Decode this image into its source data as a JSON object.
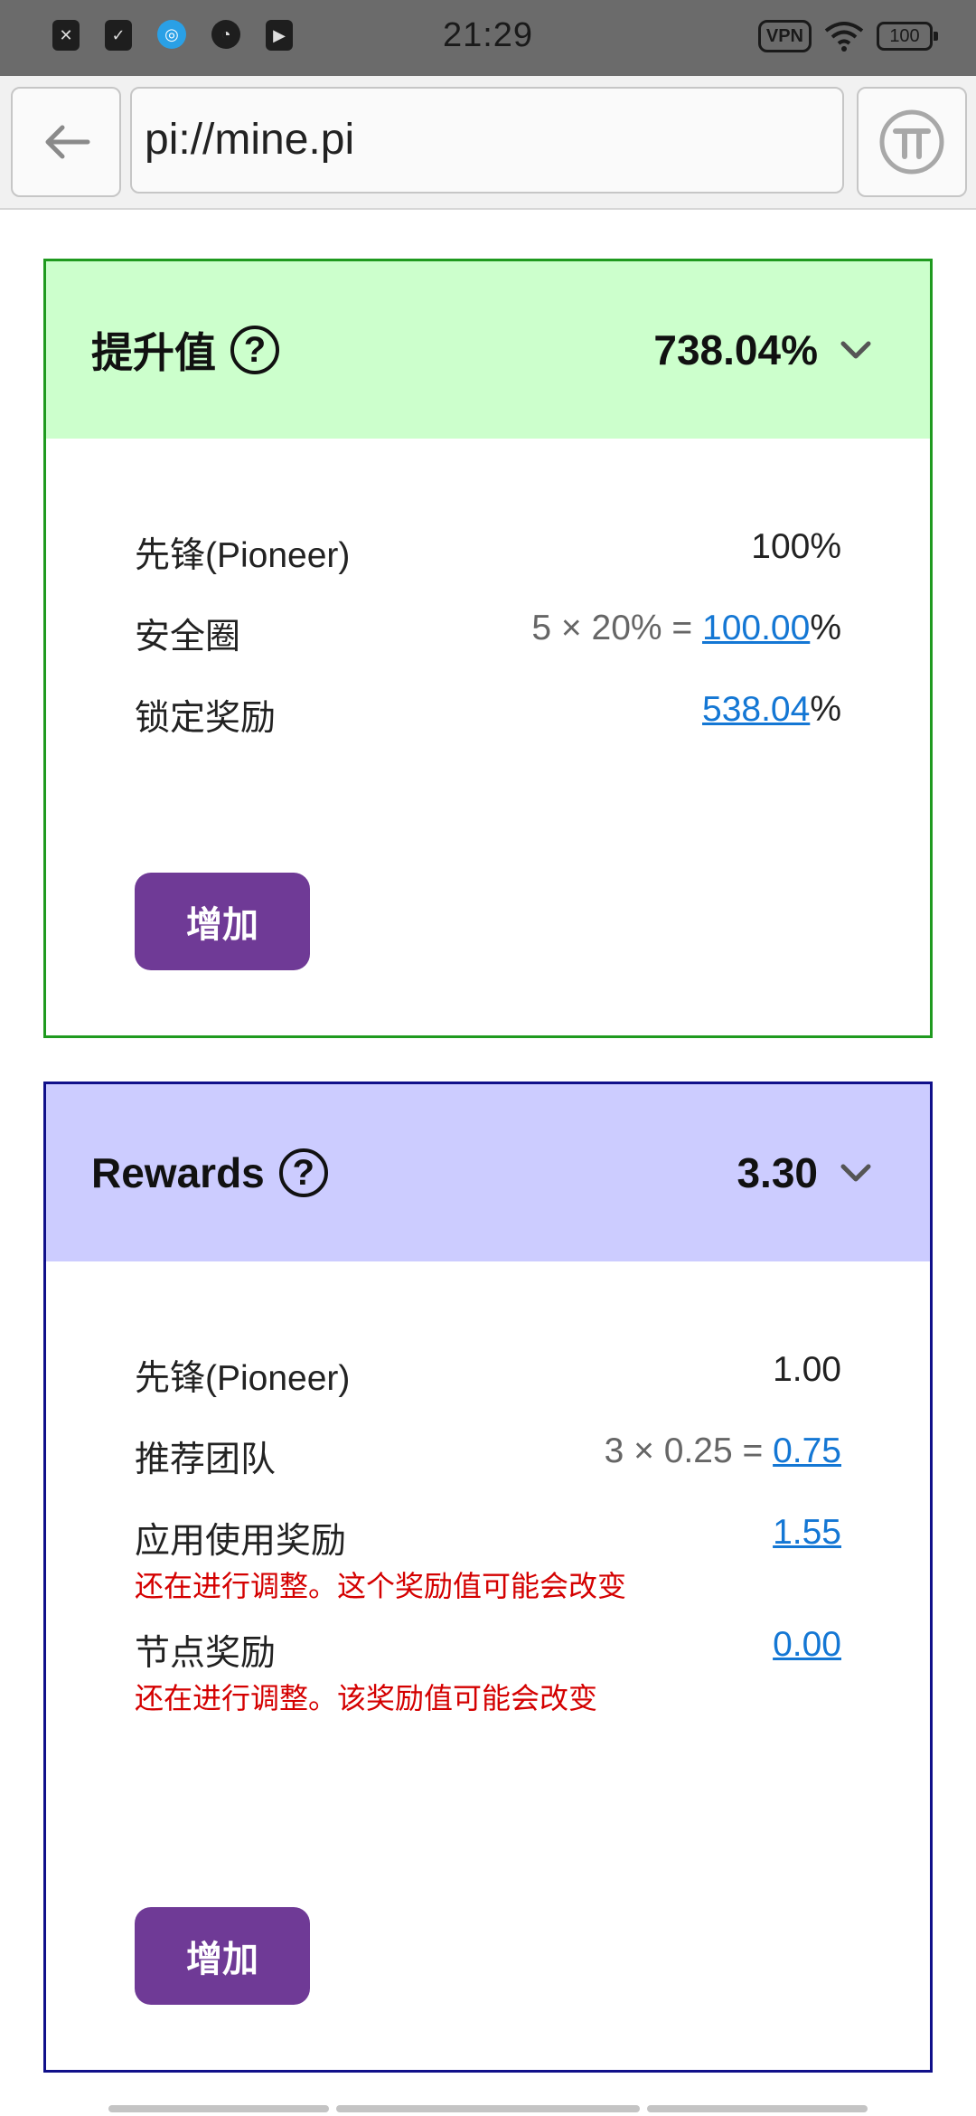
{
  "status_bar": {
    "time": "21:29",
    "vpn": "VPN",
    "battery": "100",
    "icons": [
      "close-notification-icon",
      "clipboard-check-icon",
      "app-blue-icon",
      "speed-icon",
      "media-icon"
    ]
  },
  "browser": {
    "url": "pi://mine.pi",
    "back_icon": "arrow-left-icon",
    "pi_icon": "pi-logo-icon"
  },
  "boost_card": {
    "title": "提升值",
    "help": "?",
    "value": "738.04%",
    "rows": [
      {
        "label": "先锋(Pioneer)",
        "value_plain": "100%"
      },
      {
        "label": "安全圈",
        "calc": "5 × 20% = ",
        "link": "100.00",
        "suffix": "%"
      },
      {
        "label": "锁定奖励",
        "link": "538.04",
        "suffix": "%"
      }
    ],
    "button": "增加",
    "border_color": "#1f9a1f",
    "header_color": "#ccffcc"
  },
  "rewards_card": {
    "title": "Rewards",
    "help": "?",
    "value": "3.30",
    "rows": [
      {
        "label": "先锋(Pioneer)",
        "value_plain": "1.00"
      },
      {
        "label": "推荐团队",
        "calc": "3 × 0.25 = ",
        "link": "0.75"
      },
      {
        "label": "应用使用奖励",
        "link": "1.55",
        "warning": "还在进行调整。这个奖励值可能会改变"
      },
      {
        "label": "节点奖励",
        "link": "0.00",
        "warning": "还在进行调整。该奖励值可能会改变"
      }
    ],
    "button": "增加",
    "border_color": "#10108a",
    "header_color": "#ccccff"
  },
  "colors": {
    "link": "#1477d4",
    "button": "#6f3a96",
    "warning": "#d40000"
  }
}
